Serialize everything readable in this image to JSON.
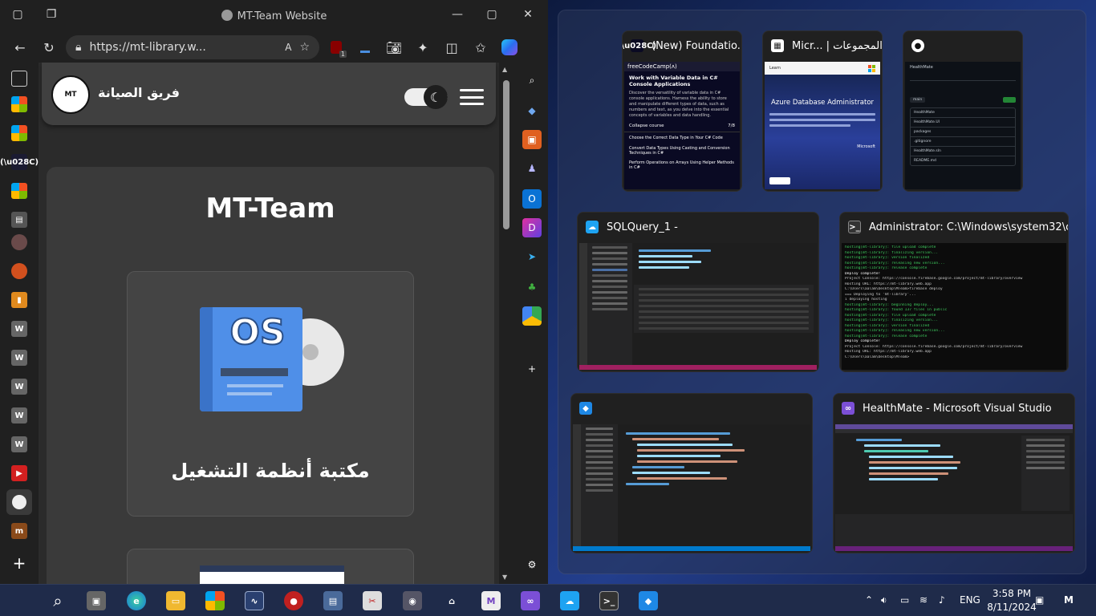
{
  "browser": {
    "title": "MT-Team Website",
    "url": "https://mt-library.w...",
    "read_aloud": "Ä́",
    "badge_count": "1"
  },
  "site": {
    "name": "فريق الصيانة",
    "logo_text": "MT",
    "page_title": "MT-Team",
    "os_card_label": "مكتبة أنظمة التشغيل",
    "os_icon_text": "OS"
  },
  "snap": {
    "windows": [
      {
        "title": "(New) Foundatio...",
        "icon": "freecodecamp-icon"
      },
      {
        "title": "Micr... | المجموعات",
        "icon": "microsoft-learn-icon"
      },
      {
        "title": "",
        "icon": "github-icon"
      },
      {
        "title": "SQLQuery_1 -",
        "icon": "azure-data-studio-icon"
      },
      {
        "title": "Administrator:  C:\\Windows\\system32\\cm...",
        "icon": "terminal-icon"
      },
      {
        "title": "",
        "icon": "vscode-icon"
      },
      {
        "title": "HealthMate - Microsoft Visual Studio",
        "icon": "visual-studio-icon"
      }
    ],
    "fcc": {
      "brand": "freeCodeCamp(ʌ)",
      "heading": "Work with Variable Data in C# Console Applications",
      "desc": "Discover the versatility of variable data in C# console applications. Harness the ability to store and manipulate different types of data, such as numbers and text, as you delve into the essential concepts of variables and data handling.",
      "collapse": "Collapse course",
      "progress": "7/8",
      "items": [
        "Choose the Correct Data Type in Your C# Code",
        "Convert Data Types Using Casting and Conversion Techniques in C#",
        "Perform Operations on Arrays Using Helper Methods in C#"
      ]
    },
    "learn": {
      "heading": "Azure Database Administrator",
      "microsoft": "Microsoft",
      "learn": "Learn"
    },
    "github": {
      "repo": "HealthMate",
      "branch": "main",
      "files": [
        "HealthMate",
        "HealthMate.UI",
        "packages",
        ".gitignore",
        "HealthMate.sln",
        "README.md"
      ]
    },
    "terminal": {
      "lines": [
        "hosting[mt-library]: file upload complete",
        "hosting[mt-library]: finalizing version...",
        "hosting[mt-library]: version finalized",
        "hosting[mt-library]: releasing new version...",
        "hosting[mt-library]: release complete",
        "Deploy complete!",
        "Project Console: https://console.firebase.google.com/project/mt-library/overview",
        "Hosting URL: https://mt-library.web.app",
        "C:\\Users\\aalam\\Desktop\\MTeam>firebase deploy",
        "=== Deploying to 'mt-library'...",
        "i  deploying hosting",
        "hosting[mt-library]: beginning deploy...",
        "hosting[mt-library]: found 137 files in public",
        "hosting[mt-library]: file upload complete",
        "hosting[mt-library]: finalizing version...",
        "hosting[mt-library]: version finalized",
        "hosting[mt-library]: releasing new version...",
        "hosting[mt-library]: release complete",
        "Deploy complete!",
        "Project Console: https://console.firebase.google.com/project/mt-library/overview",
        "Hosting URL: https://mt-library.web.app",
        "C:\\Users\\aalam\\Desktop\\MTeam>"
      ]
    }
  },
  "tray": {
    "lang": "ENG",
    "time": "3:58 PM",
    "date": "8/11/2024"
  },
  "colors": {
    "accent": "#0a66c2",
    "edge_blue": "#1e88e5",
    "os_blue": "#4f8fe8"
  }
}
